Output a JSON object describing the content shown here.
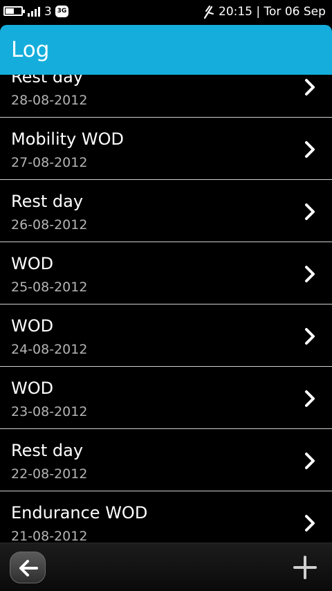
{
  "status_bar": {
    "battery_level": 0.55,
    "carrier": "3",
    "network": "3G",
    "time_date": "20:15 | Tor 06 Sep"
  },
  "header": {
    "title": "Log"
  },
  "log_items": [
    {
      "title": "Rest day",
      "date": "28-08-2012"
    },
    {
      "title": "Mobility WOD",
      "date": "27-08-2012"
    },
    {
      "title": "Rest day",
      "date": "26-08-2012"
    },
    {
      "title": "WOD",
      "date": "25-08-2012"
    },
    {
      "title": "WOD",
      "date": "24-08-2012"
    },
    {
      "title": "WOD",
      "date": "23-08-2012"
    },
    {
      "title": "Rest day",
      "date": "22-08-2012"
    },
    {
      "title": "Endurance WOD",
      "date": "21-08-2012"
    }
  ],
  "icons": {
    "item_arrow": "chevron-right-icon",
    "back": "arrow-left-icon",
    "add": "plus-icon"
  },
  "colors": {
    "header_bg": "#15aedc",
    "background": "#000000",
    "date_text": "#b4b4b4"
  }
}
